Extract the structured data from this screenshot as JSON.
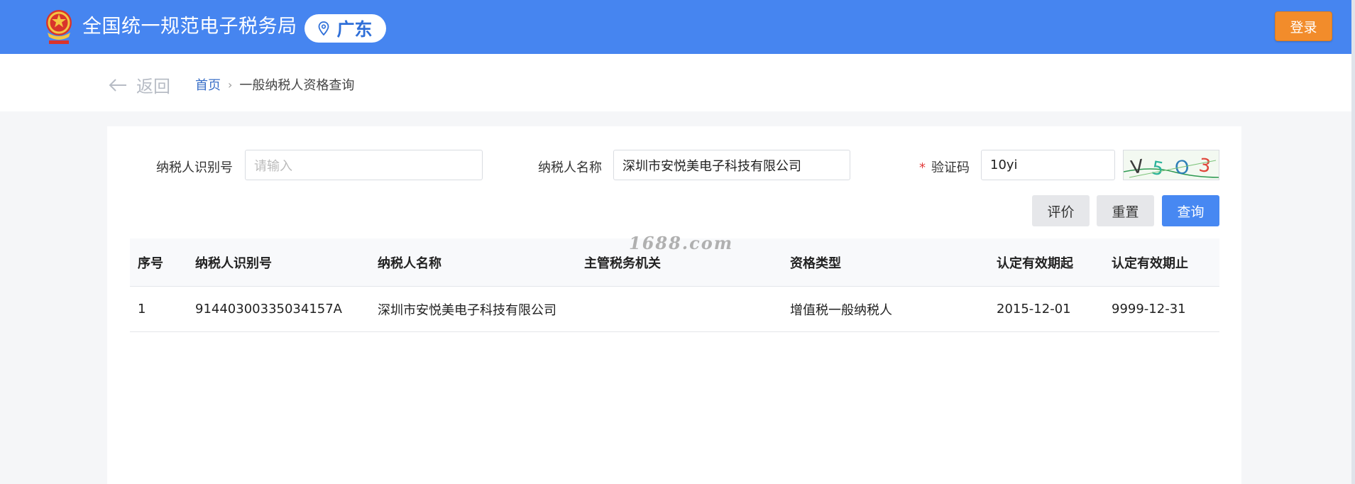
{
  "header": {
    "title": "全国统一规范电子税务局",
    "region": "广东",
    "login_label": "登录"
  },
  "nav": {
    "back_label": "返回",
    "breadcrumb_home": "首页",
    "breadcrumb_separator": "›",
    "breadcrumb_current": "一般纳税人资格查询"
  },
  "form": {
    "taxpayer_id_label": "纳税人识别号",
    "taxpayer_id_placeholder": "请输入",
    "taxpayer_id_value": "",
    "taxpayer_name_label": "纳税人名称",
    "taxpayer_name_value": "深圳市安悦美电子科技有限公司",
    "captcha_required_mark": "*",
    "captcha_label": "验证码",
    "captcha_value": "10yi",
    "captcha_image_text": "V5O3"
  },
  "buttons": {
    "evaluate": "评价",
    "reset": "重置",
    "query": "查询"
  },
  "watermark": "1688.com",
  "table": {
    "columns": [
      "序号",
      "纳税人识别号",
      "纳税人名称",
      "主管税务机关",
      "资格类型",
      "认定有效期起",
      "认定有效期止"
    ],
    "rows": [
      [
        "1",
        "91440300335034157A",
        "深圳市安悦美电子科技有限公司",
        "",
        "增值税一般纳税人",
        "2015-12-01",
        "9999-12-31"
      ]
    ]
  },
  "colors": {
    "header_bg": "#4685f0",
    "login_bg": "#f28c2b",
    "query_bg": "#4788f2",
    "link": "#3a6fc8"
  },
  "icons": {
    "emblem": "national-emblem-icon",
    "location": "location-pin-icon",
    "back": "arrow-left-icon"
  }
}
